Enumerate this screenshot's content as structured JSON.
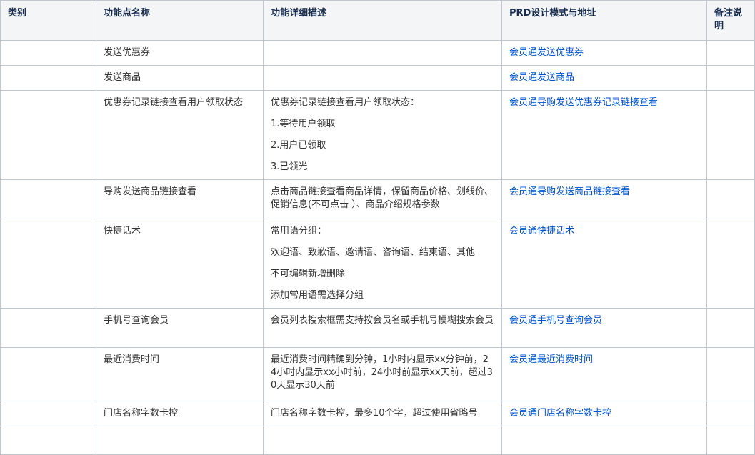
{
  "headers": {
    "category": "类别",
    "name": "功能点名称",
    "desc": "功能详细描述",
    "prd": "PRD设计模式与地址",
    "note": "备注说明"
  },
  "rows": [
    {
      "category": "",
      "name": "发送优惠券",
      "desc": [],
      "link": "会员通发送优惠券",
      "note": ""
    },
    {
      "category": "",
      "name": "发送商品",
      "desc": [],
      "link": "会员通发送商品",
      "note": ""
    },
    {
      "category": "",
      "name": "优惠券记录链接查看用户领取状态",
      "desc": [
        "优惠券记录链接查看用户领取状态：",
        "1.等待用户领取",
        "2.用户已领取",
        "3.已领光"
      ],
      "link": "会员通导购发送优惠券记录链接查看",
      "note": ""
    },
    {
      "category": "",
      "name": "导购发送商品链接查看",
      "desc": [
        "点击商品链接查看商品详情，保留商品价格、划线价、促销信息(不可点击 ）、商品介绍规格参数"
      ],
      "link": "会员通导购发送商品链接查看",
      "note": ""
    },
    {
      "category": "",
      "name": "快捷话术",
      "desc": [
        "常用语分组：",
        "欢迎语、致歉语、邀请语、咨询语、结束语、其他",
        "不可编辑新增删除",
        "添加常用语需选择分组"
      ],
      "link": "会员通快捷话术",
      "note": ""
    },
    {
      "category": "",
      "name": "手机号查询会员",
      "desc": [
        "会员列表搜索框需支持按会员名或手机号模糊搜索会员"
      ],
      "link": "会员通手机号查询会员",
      "note": ""
    },
    {
      "category": "",
      "name": "最近消费时间",
      "desc": [
        "最近消费时间精确到分钟，1小时内显示xx分钟前，24小时内显示xx小时前，24小时前显示xx天前，超过30天显示30天前"
      ],
      "link": "会员通最近消费时间",
      "note": ""
    },
    {
      "category": "",
      "name": "门店名称字数卡控",
      "desc": [
        "门店名称字数卡控，最多10个字，超过使用省略号"
      ],
      "link": "会员通门店名称字数卡控",
      "note": ""
    },
    {
      "category": "",
      "name": "",
      "desc": [],
      "link": "",
      "note": ""
    }
  ]
}
